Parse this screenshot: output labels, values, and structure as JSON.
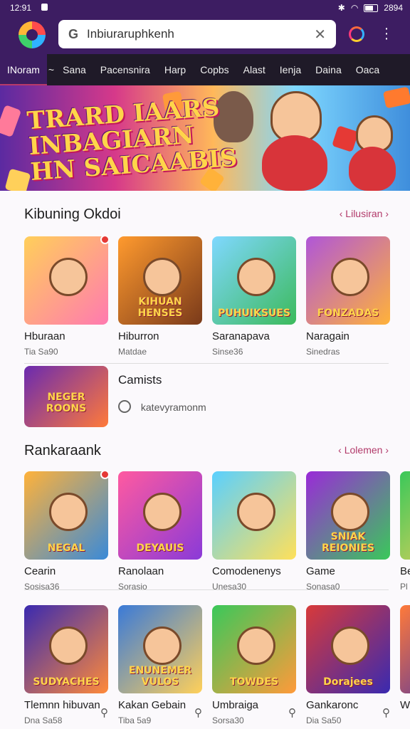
{
  "status": {
    "time": "12:91",
    "battery": "2894"
  },
  "search": {
    "text": "Inbiuraruphkenh"
  },
  "tabs": [
    {
      "label": "INoram",
      "active": true
    },
    {
      "label": "Sana"
    },
    {
      "label": "Pacensnira"
    },
    {
      "label": "Harp"
    },
    {
      "label": "Copbs"
    },
    {
      "label": "Alast"
    },
    {
      "label": "Ienja"
    },
    {
      "label": "Daina"
    },
    {
      "label": "Oaca"
    }
  ],
  "banner": {
    "title_line1": "TRARD IAARS",
    "title_line2": "INBAGIARN",
    "title_line3": "HN SAICAABIS"
  },
  "section1": {
    "title": "Kibuning Okdoi",
    "link": "Lilusiran",
    "cards": [
      {
        "thumb_label": "",
        "name": "Hburaan",
        "sub": "Tia Sa90",
        "color1": "#ffcf5a",
        "color2": "#ff7ab0",
        "dot": true
      },
      {
        "thumb_label": "KIHUAN HENSES",
        "name": "Hiburron",
        "sub": "Matdae",
        "color1": "#ff9a2e",
        "color2": "#7a3a1a"
      },
      {
        "thumb_label": "PUHUIKSUES",
        "name": "Saranapava",
        "sub": "Sinse36",
        "color1": "#7fd8ff",
        "color2": "#3cba5c"
      },
      {
        "thumb_label": "FONZADAS",
        "name": "Naragain",
        "sub": "Sinedras",
        "color1": "#b056d8",
        "color2": "#ffb23a"
      }
    ],
    "extra": {
      "thumb_label": "NEGER ROONS",
      "name": "Camists",
      "sub": "katevyramonm",
      "color1": "#6a2ab0",
      "color2": "#ff7a3a"
    }
  },
  "section2": {
    "title": "Rankaraank",
    "link": "Lolemen",
    "cards": [
      {
        "thumb_label": "NEGAL",
        "name": "Cearin",
        "sub": "Sosisa36",
        "color1": "#ffb23a",
        "color2": "#3a8ad8",
        "dot": true
      },
      {
        "thumb_label": "DEYAUIS",
        "name": "Ranolaan",
        "sub": "Sorasio",
        "color1": "#ff5aa0",
        "color2": "#8a3ad8"
      },
      {
        "thumb_label": "",
        "name": "Comodenenys",
        "sub": "Unesa30",
        "color1": "#5ad0ff",
        "color2": "#ffe05a"
      },
      {
        "thumb_label": "SNIAK REIONIES",
        "name": "Game",
        "sub": "Sonasa0",
        "color1": "#9a2ad8",
        "color2": "#3ac85a"
      }
    ],
    "partial": {
      "name": "Be",
      "sub": "Pl"
    }
  },
  "section3": {
    "cards": [
      {
        "thumb_label": "SUDYACHES",
        "name": "Tlemnn hibuvan",
        "sub": "Dna Sa58",
        "color1": "#3a2ab0",
        "color2": "#ff8a3a"
      },
      {
        "thumb_label": "ENUNEMER VULOS",
        "name": "Kakan Gebain",
        "sub": "Tiba 5a9",
        "color1": "#3a7ad8",
        "color2": "#ffd05a"
      },
      {
        "thumb_label": "TOWDES",
        "name": "Umbraiga",
        "sub": "Sorsa30",
        "color1": "#3ac85a",
        "color2": "#ff9a3a"
      },
      {
        "thumb_label": "Dorajees",
        "name": "Gankaronc",
        "sub": "Dia Sa50",
        "color1": "#d83a3a",
        "color2": "#3a2ab0"
      }
    ],
    "partial": {
      "name": "Wi",
      "sub": ""
    }
  }
}
